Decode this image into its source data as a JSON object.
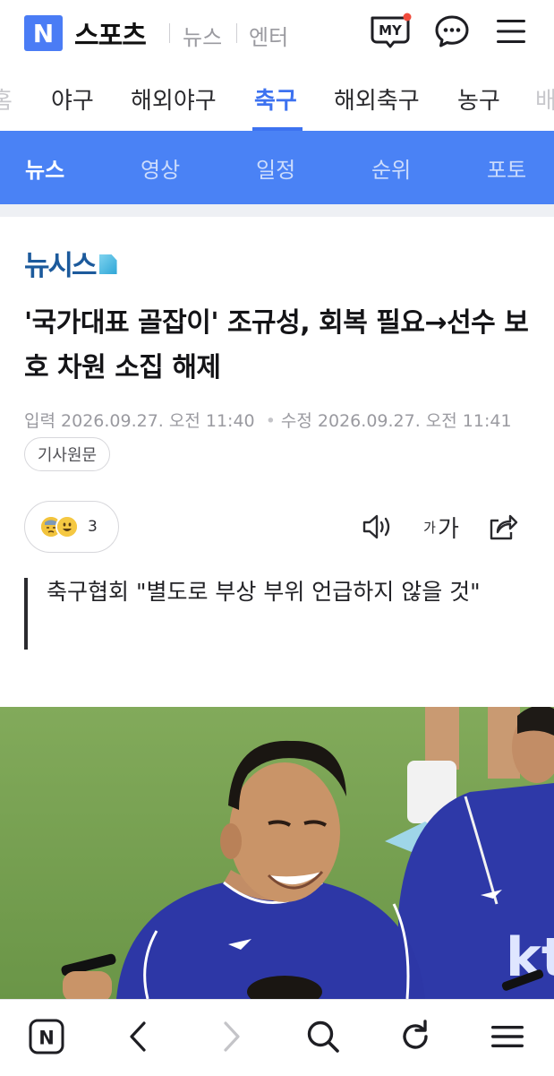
{
  "header": {
    "logo_letter": "N",
    "brand": "스포츠",
    "links": [
      "뉴스",
      "엔터"
    ],
    "my_label": "MY",
    "icons": [
      "my-icon",
      "chat-icon",
      "menu-icon"
    ],
    "notification_color": "#f04b3c"
  },
  "categories": {
    "items": [
      "홈",
      "야구",
      "해외야구",
      "축구",
      "해외축구",
      "농구",
      "배"
    ],
    "active": "축구",
    "accent": "#3d72f0"
  },
  "subnav": {
    "items": [
      "뉴스",
      "영상",
      "일정",
      "순위",
      "포토"
    ],
    "active": "뉴스",
    "background": "#4a82f5"
  },
  "article": {
    "press": "뉴시스",
    "headline": "'국가대표 골잡이' 조규성, 회복 필요→선수 보호 차원 소집 해제",
    "input_label": "입력",
    "input_time": "2026.09.27. 오전 11:40",
    "modified_label": "수정",
    "modified_time": "2026.09.27. 오전 11:41",
    "original_button": "기사원문",
    "reaction_count": "3",
    "font_size_label_small": "가",
    "font_size_label_large": "가",
    "tools": [
      "speaker-icon",
      "font-size-icon",
      "share-icon"
    ],
    "subtitle": "축구협회 \"별도로 부상 부위 언급하지 않을 것\""
  },
  "photo": {
    "jersey_text": "kt"
  },
  "bottom_bar": {
    "home_letter": "N",
    "icons": [
      "naver-home-icon",
      "back-icon",
      "forward-icon",
      "search-icon",
      "refresh-icon",
      "menu-icon"
    ]
  }
}
